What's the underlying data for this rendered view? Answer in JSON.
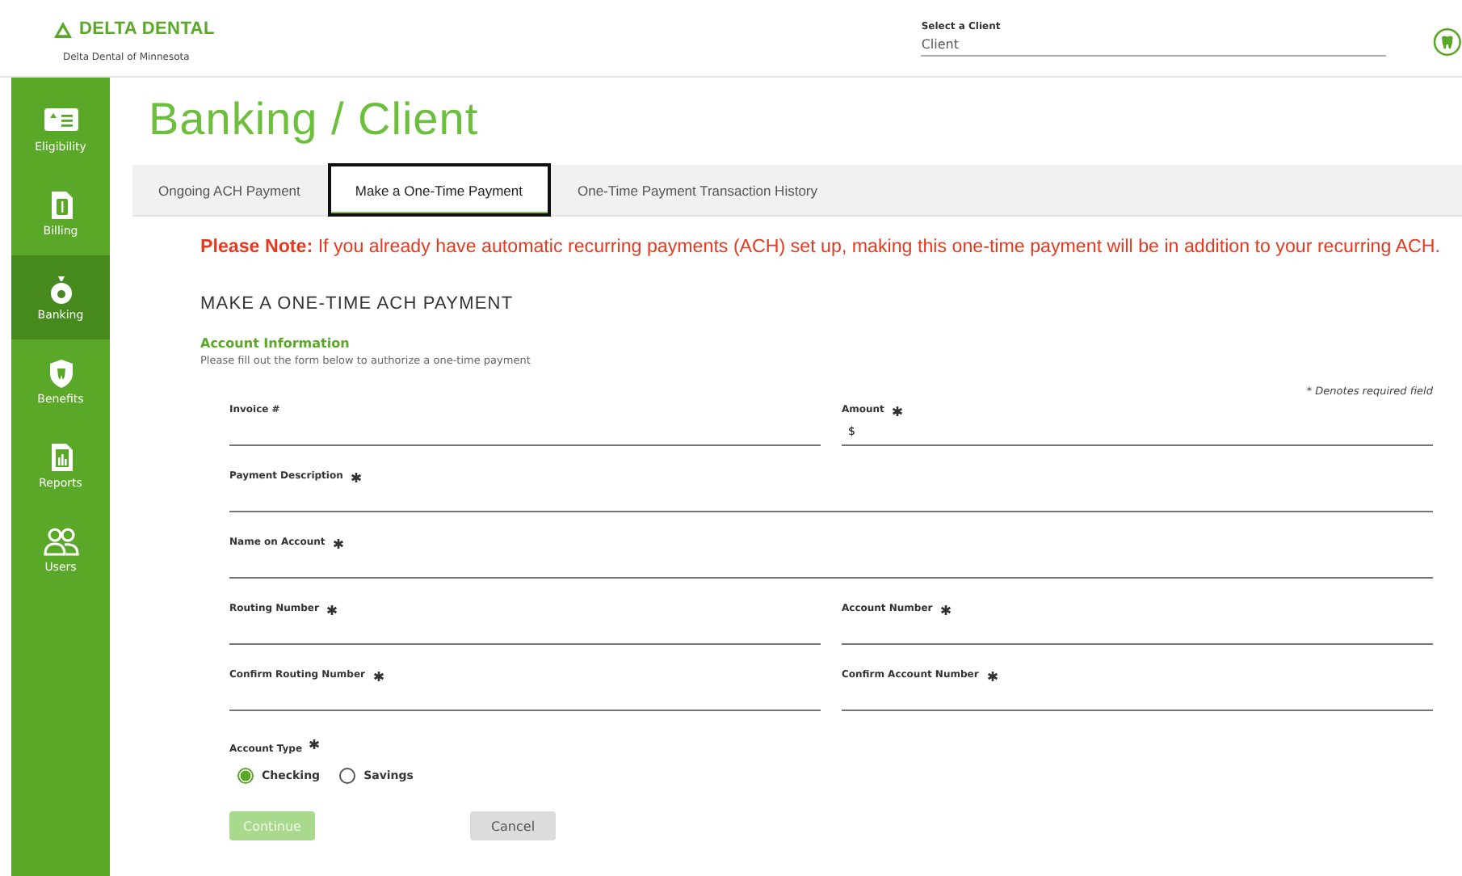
{
  "header": {
    "brand": "DELTA DENTAL",
    "subtitle": "Delta Dental of Minnesota",
    "client_select": {
      "label": "Select a Client",
      "value": "Client"
    }
  },
  "sidebar": {
    "items": [
      {
        "label": "Eligibility",
        "selected": false
      },
      {
        "label": "Billing",
        "selected": false
      },
      {
        "label": "Banking",
        "selected": true
      },
      {
        "label": "Benefits",
        "selected": false
      },
      {
        "label": "Reports",
        "selected": false
      },
      {
        "label": "Users",
        "selected": false
      }
    ]
  },
  "page_title": "Banking / Client",
  "tabs": [
    {
      "label": "Ongoing ACH Payment",
      "selected": false
    },
    {
      "label": "Make a One-Time Payment",
      "selected": true
    },
    {
      "label": "One-Time Payment Transaction History",
      "selected": false
    }
  ],
  "notice": "**Please Note:** If you already have automatic recurring payments (ACH) set up, making this one-time payment will be in addition to your recurring ACH.",
  "form": {
    "heading": "MAKE A ONE-TIME ACH PAYMENT",
    "section": "Account Information",
    "instructions": "Please fill out the form below to authorize a one-time payment",
    "required_note": "* Denotes required field",
    "fields": [
      {
        "label": "Invoice #",
        "kind": "half",
        "required": false
      },
      {
        "label": "Amount",
        "kind": "half",
        "required": true,
        "value": "$"
      },
      {
        "label": "Payment Description",
        "kind": "full",
        "required": true
      },
      {
        "label": "Name on Account",
        "kind": "full",
        "required": true
      },
      {
        "label": "Routing Number",
        "kind": "half",
        "required": true
      },
      {
        "label": "Account Number",
        "kind": "half",
        "required": true
      },
      {
        "label": "Confirm Routing Number",
        "kind": "half",
        "required": true
      },
      {
        "label": "Confirm Account Number",
        "kind": "half",
        "required": true
      }
    ],
    "account_type": {
      "label": "Account Type",
      "required": true,
      "options": [
        {
          "label": "Checking",
          "selected": true
        },
        {
          "label": "Savings",
          "selected": false
        }
      ]
    },
    "buttons": [
      {
        "label": "Continue",
        "kind": "primary",
        "disabled": true
      },
      {
        "label": "Cancel",
        "kind": "secondary",
        "disabled": false
      }
    ]
  }
}
